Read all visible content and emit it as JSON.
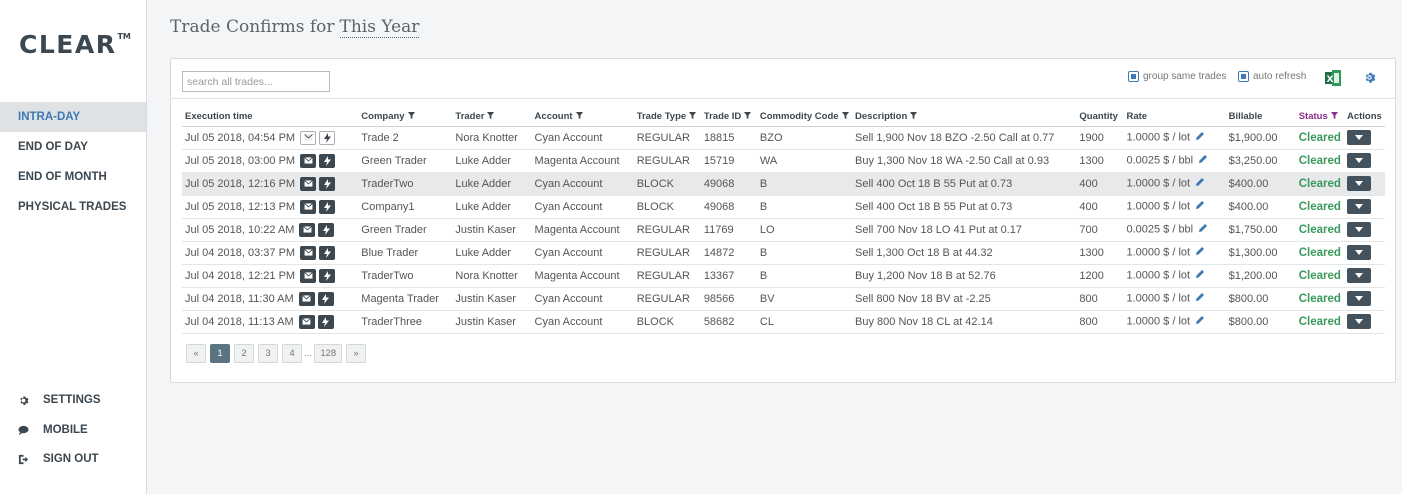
{
  "brand": {
    "name": "CLEAR",
    "tm": "TM"
  },
  "nav": {
    "items": [
      {
        "label": "INTRA-DAY",
        "active": true
      },
      {
        "label": "END OF DAY",
        "active": false
      },
      {
        "label": "END OF MONTH",
        "active": false
      },
      {
        "label": "PHYSICAL TRADES",
        "active": false
      }
    ],
    "bottom": [
      {
        "label": "SETTINGS",
        "icon": "gear-icon"
      },
      {
        "label": "MOBILE",
        "icon": "chat-bubble-icon"
      },
      {
        "label": "SIGN OUT",
        "icon": "sign-out-icon"
      }
    ]
  },
  "header": {
    "title": "Trade Confirms for",
    "period": "This Year"
  },
  "toolbar": {
    "search_placeholder": "search all trades...",
    "group_same_trades": "group same trades",
    "auto_refresh": "auto refresh",
    "excel_icon": "excel-icon",
    "settings_icon": "gear-icon"
  },
  "table": {
    "columns": [
      "Execution time",
      "Company",
      "Trader",
      "Account",
      "Trade Type",
      "Trade ID",
      "Commodity Code",
      "Description",
      "Quantity",
      "Rate",
      "Billable",
      "Status",
      "Actions"
    ],
    "rows": [
      {
        "time": "Jul 05 2018, 04:54 PM",
        "company": "Trade 2",
        "trader": "Nora Knotter",
        "account": "Cyan Account",
        "type": "REGULAR",
        "id": "18815",
        "code": "BZO",
        "desc": "Sell 1,900 Nov 18 BZO -2.50 Call at 0.77",
        "qty": "1900",
        "rate": "1.0000 $ / lot",
        "billable": "$1,900.00",
        "status": "Cleared",
        "light_icons": true
      },
      {
        "time": "Jul 05 2018, 03:00 PM",
        "company": "Green Trader",
        "trader": "Luke Adder",
        "account": "Magenta Account",
        "type": "REGULAR",
        "id": "15719",
        "code": "WA",
        "desc": "Buy 1,300 Nov 18 WA -2.50 Call at 0.93",
        "qty": "1300",
        "rate": "0.0025 $ / bbl",
        "billable": "$3,250.00",
        "status": "Cleared"
      },
      {
        "time": "Jul 05 2018, 12:16 PM",
        "company": "TraderTwo",
        "trader": "Luke Adder",
        "account": "Cyan Account",
        "type": "BLOCK",
        "id": "49068",
        "code": "B",
        "desc": "Sell 400 Oct 18 B 55 Put at 0.73",
        "qty": "400",
        "rate": "1.0000 $ / lot",
        "billable": "$400.00",
        "status": "Cleared",
        "highlight": true
      },
      {
        "time": "Jul 05 2018, 12:13 PM",
        "company": "Company1",
        "trader": "Luke Adder",
        "account": "Cyan Account",
        "type": "BLOCK",
        "id": "49068",
        "code": "B",
        "desc": "Sell 400 Oct 18 B 55 Put at 0.73",
        "qty": "400",
        "rate": "1.0000 $ / lot",
        "billable": "$400.00",
        "status": "Cleared"
      },
      {
        "time": "Jul 05 2018, 10:22 AM",
        "company": "Green Trader",
        "trader": "Justin Kaser",
        "account": "Magenta Account",
        "type": "REGULAR",
        "id": "11769",
        "code": "LO",
        "desc": "Sell 700 Nov 18 LO 41 Put at 0.17",
        "qty": "700",
        "rate": "0.0025 $ / bbl",
        "billable": "$1,750.00",
        "status": "Cleared"
      },
      {
        "time": "Jul 04 2018, 03:37 PM",
        "company": "Blue Trader",
        "trader": "Luke Adder",
        "account": "Cyan Account",
        "type": "REGULAR",
        "id": "14872",
        "code": "B",
        "desc": "Sell 1,300 Oct 18 B at 44.32",
        "qty": "1300",
        "rate": "1.0000 $ / lot",
        "billable": "$1,300.00",
        "status": "Cleared"
      },
      {
        "time": "Jul 04 2018, 12:21 PM",
        "company": "TraderTwo",
        "trader": "Nora Knotter",
        "account": "Magenta Account",
        "type": "REGULAR",
        "id": "13367",
        "code": "B",
        "desc": "Buy 1,200 Nov 18 B at 52.76",
        "qty": "1200",
        "rate": "1.0000 $ / lot",
        "billable": "$1,200.00",
        "status": "Cleared"
      },
      {
        "time": "Jul 04 2018, 11:30 AM",
        "company": "Magenta Trader",
        "trader": "Justin Kaser",
        "account": "Cyan Account",
        "type": "REGULAR",
        "id": "98566",
        "code": "BV",
        "desc": "Sell 800 Nov 18 BV at -2.25",
        "qty": "800",
        "rate": "1.0000 $ / lot",
        "billable": "$800.00",
        "status": "Cleared"
      },
      {
        "time": "Jul 04 2018, 11:13 AM",
        "company": "TraderThree",
        "trader": "Justin Kaser",
        "account": "Cyan Account",
        "type": "BLOCK",
        "id": "58682",
        "code": "CL",
        "desc": "Buy 800 Nov 18 CL at 42.14",
        "qty": "800",
        "rate": "1.0000 $ / lot",
        "billable": "$800.00",
        "status": "Cleared"
      }
    ]
  },
  "pagination": {
    "prev": "«",
    "pages": [
      "1",
      "2",
      "3",
      "4"
    ],
    "ellipsis": "...",
    "last": "128",
    "next": "»",
    "current": "1"
  },
  "colors": {
    "accent": "#3d79b5",
    "cleared": "#3a9a5b",
    "dark": "#3c4750",
    "status_header": "#8b2f8b"
  }
}
